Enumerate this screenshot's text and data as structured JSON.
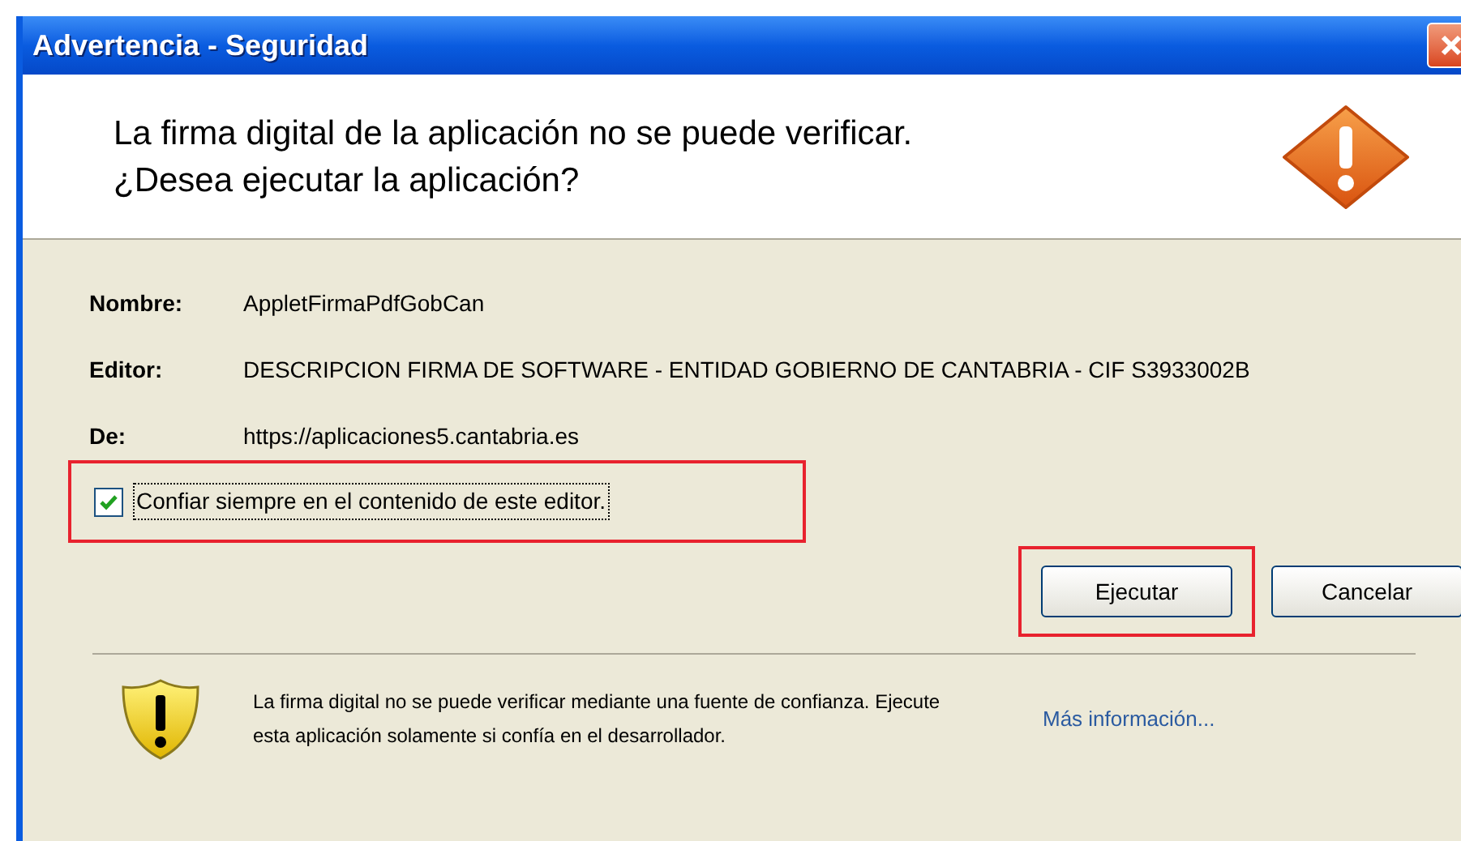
{
  "window": {
    "title": "Advertencia - Seguridad"
  },
  "header": {
    "lines": [
      "La firma digital de la aplicación no se puede verificar.",
      "¿Desea ejecutar la aplicación?"
    ]
  },
  "details": [
    {
      "label": "Nombre:",
      "value": "AppletFirmaPdfGobCan"
    },
    {
      "label": "Editor:",
      "value": "DESCRIPCION FIRMA DE SOFTWARE - ENTIDAD GOBIERNO DE CANTABRIA - CIF S3933002B"
    },
    {
      "label": "De:",
      "value": "https://aplicaciones5.cantabria.es"
    }
  ],
  "trust_checkbox": {
    "label": "Confiar siempre en el contenido de este editor.",
    "checked": true
  },
  "buttons": [
    {
      "label": "Ejecutar",
      "highlighted": true
    },
    {
      "label": "Cancelar",
      "highlighted": false
    }
  ],
  "footer": {
    "message": "La firma digital no se puede verificar mediante una fuente de confianza.  Ejecute esta aplicación solamente si confía en el desarrollador.",
    "link": "Más información..."
  }
}
